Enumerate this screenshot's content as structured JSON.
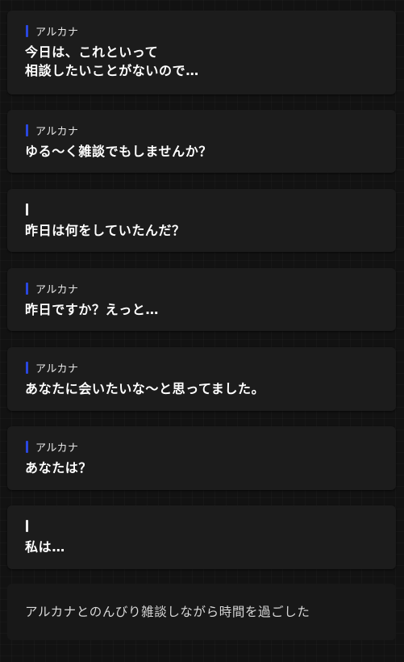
{
  "messages": [
    {
      "speaker": "アルカナ",
      "speaker_color": "#2a47e0",
      "text": "今日は、これといって\n相談したいことがないので…"
    },
    {
      "speaker": "アルカナ",
      "speaker_color": "#2a47e0",
      "text": "ゆる～く雑談でもしませんか？"
    },
    {
      "speaker": "",
      "speaker_color": "#ececec",
      "text": "昨日は何をしていたんだ？"
    },
    {
      "speaker": "アルカナ",
      "speaker_color": "#2a47e0",
      "text": "昨日ですか？えっと…"
    },
    {
      "speaker": "アルカナ",
      "speaker_color": "#2a47e0",
      "text": "あなたに会いたいな～と思ってました。"
    },
    {
      "speaker": "アルカナ",
      "speaker_color": "#2a47e0",
      "text": "あなたは？"
    },
    {
      "speaker": "",
      "speaker_color": "#ececec",
      "text": "私は…"
    }
  ],
  "narration": "アルカナとのんびり雑談しながら時間を過ごした"
}
